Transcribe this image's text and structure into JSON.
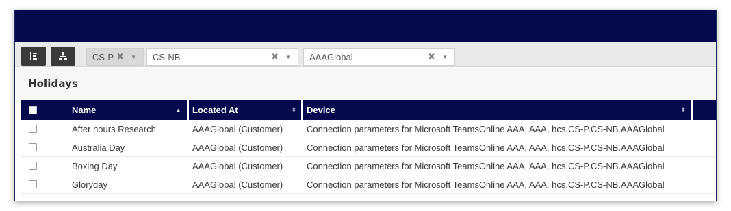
{
  "toolbar": {
    "filters": [
      {
        "value": "CS-P"
      },
      {
        "value": "CS-NB"
      },
      {
        "value": "AAAGlobal"
      }
    ]
  },
  "section_title": "Holidays",
  "table": {
    "columns": [
      {
        "label": "Name",
        "sort": "asc"
      },
      {
        "label": "Located At",
        "sort": "none"
      },
      {
        "label": "Device",
        "sort": "none"
      }
    ],
    "rows": [
      {
        "name": "After hours Research",
        "located_at": "AAAGlobal (Customer)",
        "device": "Connection parameters for Microsoft TeamsOnline AAA, AAA, hcs.CS-P.CS-NB.AAAGlobal"
      },
      {
        "name": "Australia Day",
        "located_at": "AAAGlobal (Customer)",
        "device": "Connection parameters for Microsoft TeamsOnline AAA, AAA, hcs.CS-P.CS-NB.AAAGlobal"
      },
      {
        "name": "Boxing Day",
        "located_at": "AAAGlobal (Customer)",
        "device": "Connection parameters for Microsoft TeamsOnline AAA, AAA, hcs.CS-P.CS-NB.AAAGlobal"
      },
      {
        "name": "Gloryday",
        "located_at": "AAAGlobal (Customer)",
        "device": "Connection parameters for Microsoft TeamsOnline AAA, AAA, hcs.CS-P.CS-NB.AAAGlobal"
      }
    ]
  },
  "icons": {
    "list_view": "list-tree-icon",
    "hierarchy_view": "hierarchy-icon",
    "clear": "close-icon",
    "dropdown": "caret-down-icon",
    "sort": "sort-icon"
  },
  "colors": {
    "header_bg": "#050a4f",
    "toolbar_bg": "#e9e9e9",
    "tool_button_bg": "#3a3a3a"
  }
}
